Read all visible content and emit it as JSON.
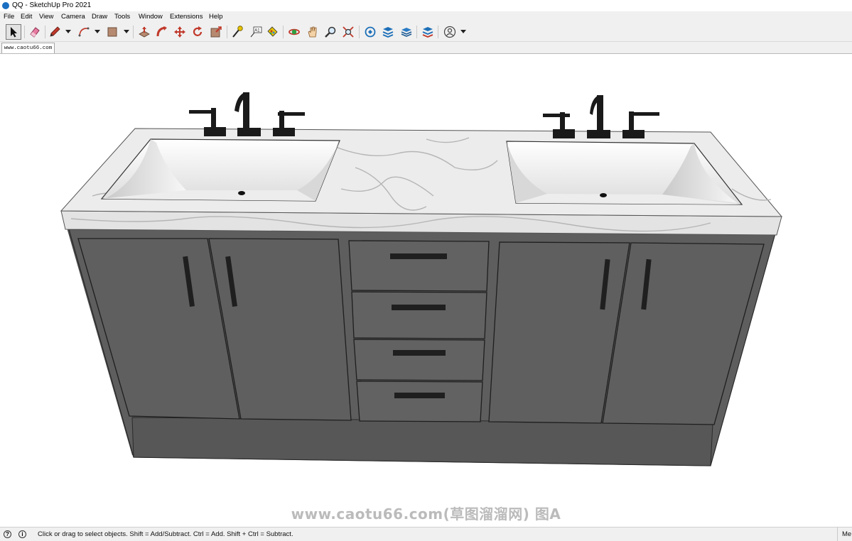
{
  "window": {
    "title": "QQ - SketchUp Pro 2021"
  },
  "menu": [
    "File",
    "Edit",
    "View",
    "Camera",
    "Draw",
    "Tools",
    "Window",
    "Extensions",
    "Help"
  ],
  "toolbar": {
    "tools": [
      {
        "name": "select-tool",
        "icon": "arrow-cursor-icon"
      },
      {
        "name": "eraser-tool",
        "icon": "eraser-icon"
      },
      {
        "name": "line-tool",
        "icon": "pencil-icon"
      },
      {
        "name": "arc-tool",
        "icon": "arc-icon"
      },
      {
        "name": "rectangle-tool",
        "icon": "rectangle-icon"
      },
      {
        "name": "push-pull-tool",
        "icon": "push-pull-icon"
      },
      {
        "name": "follow-me-tool",
        "icon": "follow-me-icon"
      },
      {
        "name": "move-tool",
        "icon": "move-icon"
      },
      {
        "name": "rotate-tool",
        "icon": "rotate-icon"
      },
      {
        "name": "scale-tool",
        "icon": "scale-icon"
      },
      {
        "name": "tape-measure-tool",
        "icon": "tape-measure-icon"
      },
      {
        "name": "text-tool",
        "icon": "text-icon"
      },
      {
        "name": "paint-bucket-tool",
        "icon": "paint-bucket-icon"
      },
      {
        "name": "orbit-tool",
        "icon": "orbit-icon"
      },
      {
        "name": "pan-tool",
        "icon": "hand-icon"
      },
      {
        "name": "zoom-tool",
        "icon": "magnifier-icon"
      },
      {
        "name": "zoom-extents-tool",
        "icon": "zoom-extents-icon"
      },
      {
        "name": "3d-warehouse-button",
        "icon": "warehouse-icon"
      },
      {
        "name": "extension-warehouse-button",
        "icon": "extension-warehouse-icon"
      },
      {
        "name": "layout-button",
        "icon": "layout-icon"
      },
      {
        "name": "extension-manager-button",
        "icon": "extension-manager-icon"
      },
      {
        "name": "account-button",
        "icon": "user-account-icon"
      }
    ]
  },
  "scene_tab": {
    "label": "www.caotu66.com"
  },
  "watermark": "www.caotu66.com(草图溜溜网) 图A",
  "status": {
    "hint": "Click or drag to select objects. Shift = Add/Subtract. Ctrl = Add. Shift + Ctrl = Subtract.",
    "measurements_label": "Me"
  },
  "colors": {
    "cabinet": "#5e5e5e",
    "cabinet_side": "#4a4a4a",
    "countertop": "#e9e9e9",
    "hardware": "#1f1f1f"
  }
}
